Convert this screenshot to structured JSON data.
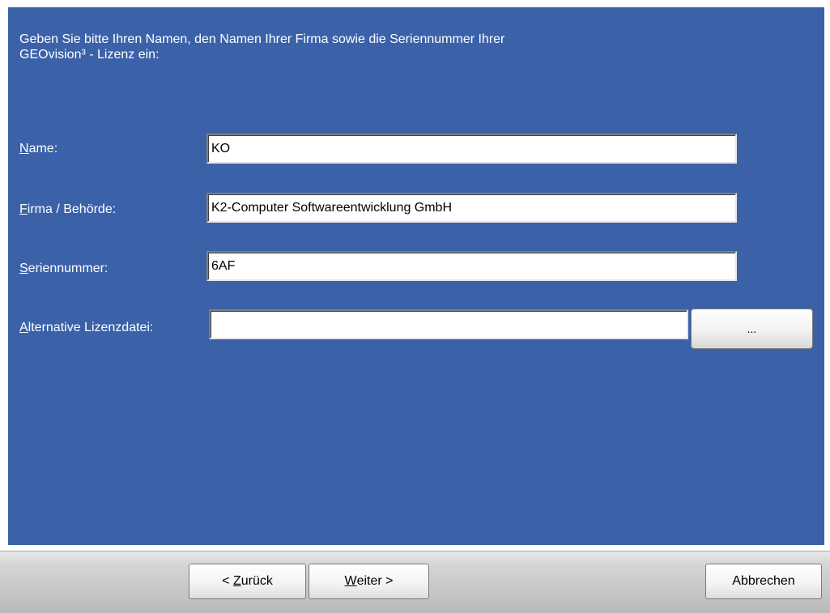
{
  "instructions": {
    "line1": "Geben Sie bitte Ihren Namen, den Namen Ihrer Firma sowie die Seriennummer Ihrer",
    "line2": "GEOvision³ - Lizenz ein:"
  },
  "fields": {
    "name": {
      "mnemonic": "N",
      "label_rest": "ame:",
      "value": "KO"
    },
    "firma": {
      "mnemonic": "F",
      "label_rest": "irma / Behörde:",
      "value": "K2-Computer Softwareentwicklung GmbH"
    },
    "serial": {
      "mnemonic": "S",
      "label_rest": "eriennummer:",
      "value": "6AF"
    },
    "license_file": {
      "mnemonic": "A",
      "label_rest": "lternative Lizenzdatei:",
      "value": ""
    }
  },
  "browse_button": {
    "label": "..."
  },
  "buttons": {
    "back": {
      "prefix": "< ",
      "mnemonic": "Z",
      "rest": "urück"
    },
    "next": {
      "mnemonic": "W",
      "rest": "eiter >"
    },
    "cancel": {
      "label": "Abbrechen"
    }
  },
  "colors": {
    "panel_background": "#3b62a9",
    "label_text": "#ffffff"
  }
}
